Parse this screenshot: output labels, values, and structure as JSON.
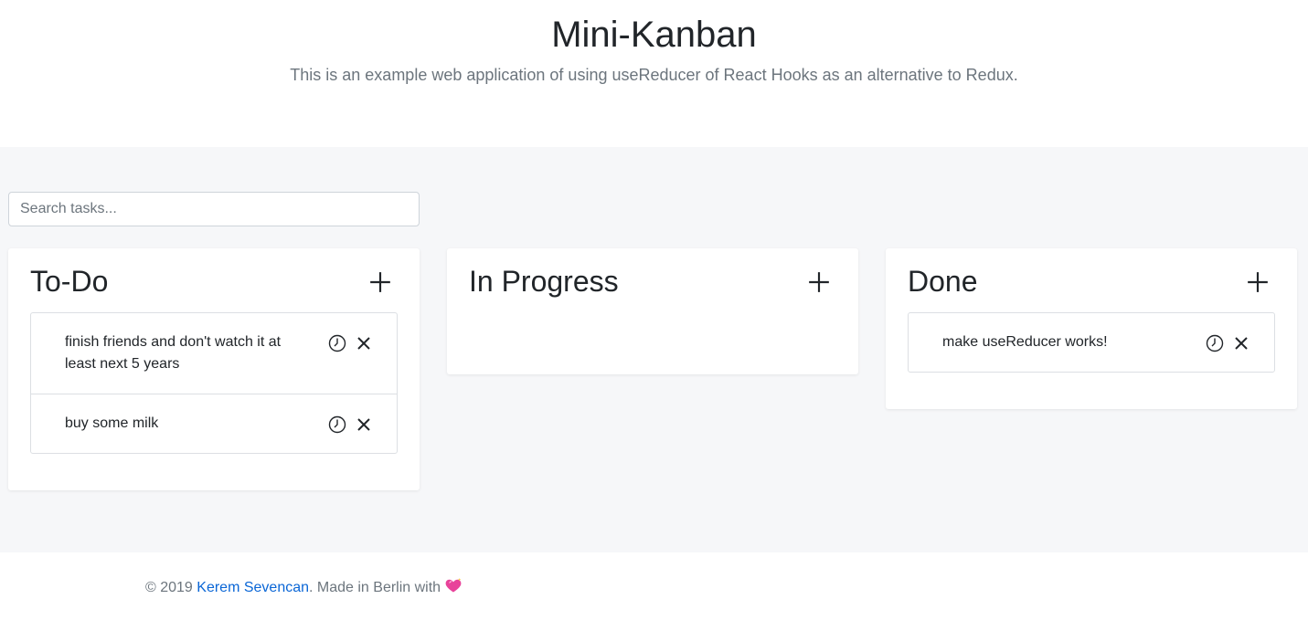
{
  "header": {
    "title": "Mini-Kanban",
    "subtitle_before": "This is an example web application of using ",
    "subtitle_highlight": "useReducer",
    "subtitle_after": " of React Hooks as an alternative to Redux."
  },
  "search": {
    "placeholder": "Search tasks...",
    "value": ""
  },
  "columns": [
    {
      "title": "To-Do",
      "tasks": [
        {
          "text": "finish friends and don't watch it at least next 5 years"
        },
        {
          "text": "buy some milk"
        }
      ]
    },
    {
      "title": "In Progress",
      "tasks": []
    },
    {
      "title": "Done",
      "tasks": [
        {
          "text": "make useReducer works!"
        }
      ]
    }
  ],
  "footer": {
    "copyright": "© 2019 ",
    "author": "Kerem Sevencan",
    "made_in": ". Made in Berlin with",
    "heart_icon": "sparkling-heart-icon"
  },
  "icons": {
    "add": "plus-icon",
    "clock": "clock-icon",
    "delete": "close-icon"
  },
  "colors": {
    "main_bg": "#f6f7f9",
    "link": "#0a66d6",
    "heart": "#e8439a"
  }
}
